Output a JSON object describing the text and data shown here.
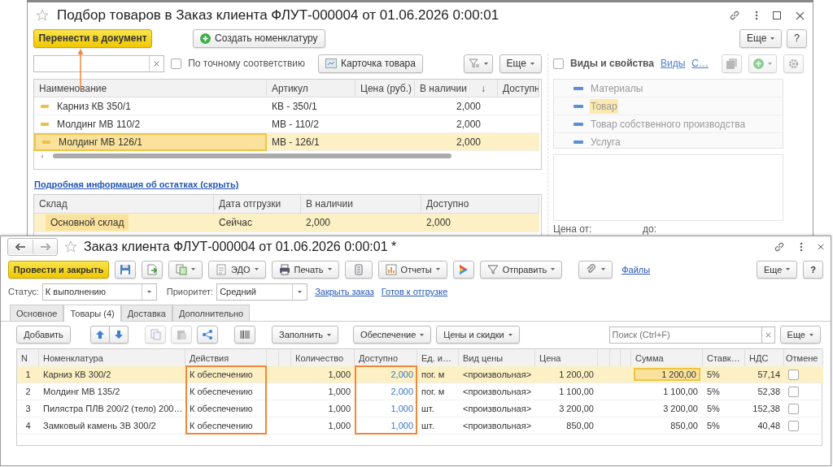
{
  "back_window": {
    "title": "Подбор товаров в Заказ клиента ФЛУТ-000004 от 01.06.2026 0:00:01",
    "transfer_button": "Перенести в документ",
    "create_button": "Создать номенклатуру",
    "more_button": "Еще",
    "help_button": "?",
    "exact_match": {
      "label": "По точному соответствию",
      "checked": false
    },
    "card_button": "Карточка товара",
    "list_more_button": "Еще",
    "products": {
      "columns": [
        {
          "label": "Наименование"
        },
        {
          "label": "Артикул"
        },
        {
          "label": "Цена (руб.)"
        },
        {
          "label": "В наличии",
          "sort_mark": "↓"
        },
        {
          "label": "Доступн"
        }
      ],
      "rows": [
        {
          "name": "Карниз КВ 350/1",
          "article": "КВ - 350/1",
          "in_stock": "2,000",
          "selected": false
        },
        {
          "name": "Молдинг МВ 110/2",
          "article": "МВ - 110/2",
          "in_stock": "2,000",
          "selected": false
        },
        {
          "name": "Молдинг МВ 126/1",
          "article": "МВ - 126/1",
          "in_stock": "2,000",
          "selected": true
        }
      ]
    },
    "details_link": "Подробная информация об остатках (скрыть)",
    "stock": {
      "columns": [
        "Склад",
        "Дата отгрузки",
        "В наличии",
        "Доступно"
      ],
      "rows": [
        {
          "warehouse": "Основной склад",
          "date": "Сейчас",
          "in_stock": "2,000",
          "available": "2,000",
          "selected": true
        }
      ]
    },
    "properties": {
      "label": "Виды и свойства",
      "checked": false,
      "links": [
        "Виды",
        "С…"
      ],
      "items": [
        {
          "label": "Материалы",
          "selected": false
        },
        {
          "label": "Товар",
          "selected": true
        },
        {
          "label": "Товар собственного производства",
          "selected": false
        },
        {
          "label": "Услуга",
          "selected": false
        }
      ]
    },
    "price_from_label": "Цена от:",
    "price_to_label": "до:"
  },
  "front_window": {
    "title": "Заказ клиента ФЛУТ-000004 от 01.06.2026 0:00:01 *",
    "post_button": "Провести и закрыть",
    "edo_button": "ЭДО",
    "print_button": "Печать",
    "reports_button": "Отчеты",
    "send_button": "Отправить",
    "files_link": "Файлы",
    "more_button": "Еще",
    "help_button": "?",
    "status": {
      "label": "Статус:",
      "value": "К выполнению"
    },
    "priority": {
      "label": "Приоритет:",
      "value": "Средний"
    },
    "links": [
      "Закрыть заказ",
      "Готов к отгрузке"
    ],
    "tabs": [
      {
        "label": "Основное",
        "selected": false
      },
      {
        "label": "Товары (4)",
        "selected": true
      },
      {
        "label": "Доставка",
        "selected": false
      },
      {
        "label": "Дополнительно",
        "selected": false
      }
    ],
    "table_toolbar": {
      "add_button": "Добавить",
      "fill_button": "Заполнить",
      "supply_button": "Обеспечение",
      "prices_button": "Цены и скидки",
      "search_placeholder": "Поиск (Ctrl+F)",
      "more_button": "Еще"
    },
    "columns": [
      {
        "label": "N",
        "highlighted": false
      },
      {
        "label": "Номенклатура",
        "highlighted": false
      },
      {
        "label": "Действия",
        "highlighted": true
      },
      {
        "label": "Количество",
        "highlighted": false
      },
      {
        "label": "Доступно",
        "highlighted": true
      },
      {
        "label": "Ед. и…",
        "highlighted": false
      },
      {
        "label": "Вид цены",
        "highlighted": false
      },
      {
        "label": "Цена",
        "highlighted": false
      },
      {
        "label": "Сумма",
        "highlighted": false
      },
      {
        "label": "Ставк…",
        "highlighted": false
      },
      {
        "label": "НДС",
        "highlighted": false
      },
      {
        "label": "Отмене",
        "highlighted": false
      }
    ],
    "rows": [
      {
        "n": "1",
        "name": "Карниз КВ 300/2",
        "action": "К обеспечению",
        "quantity": "1,000",
        "available": "2,000",
        "unit": "пог. м",
        "price_type": "<произвольная>",
        "price": "1 200,00",
        "sum": "1 200,00",
        "vat_rate": "5%",
        "vat": "57,14",
        "cancelled": false,
        "selected": true
      },
      {
        "n": "2",
        "name": "Молдинг МВ 135/2",
        "action": "К обеспечению",
        "quantity": "1,000",
        "available": "2,000",
        "unit": "пог. м",
        "price_type": "<произвольная>",
        "price": "1 100,00",
        "sum": "1 100,00",
        "vat_rate": "5%",
        "vat": "52,38",
        "cancelled": false,
        "selected": false
      },
      {
        "n": "3",
        "name": "Пилястра ПЛВ 200/2 (тело) 200…",
        "action": "К обеспечению",
        "quantity": "1,000",
        "available": "1,000",
        "unit": "шт.",
        "price_type": "<произвольная>",
        "price": "3 200,00",
        "sum": "3 200,00",
        "vat_rate": "5%",
        "vat": "152,38",
        "cancelled": false,
        "selected": false
      },
      {
        "n": "4",
        "name": "Замковый камень ЗВ 300/2",
        "action": "К обеспечению",
        "quantity": "1,000",
        "available": "1,000",
        "unit": "шт.",
        "price_type": "<произвольная>",
        "price": "850,00",
        "sum": "850,00",
        "vat_rate": "5%",
        "vat": "40,48",
        "cancelled": false,
        "selected": false
      }
    ]
  }
}
